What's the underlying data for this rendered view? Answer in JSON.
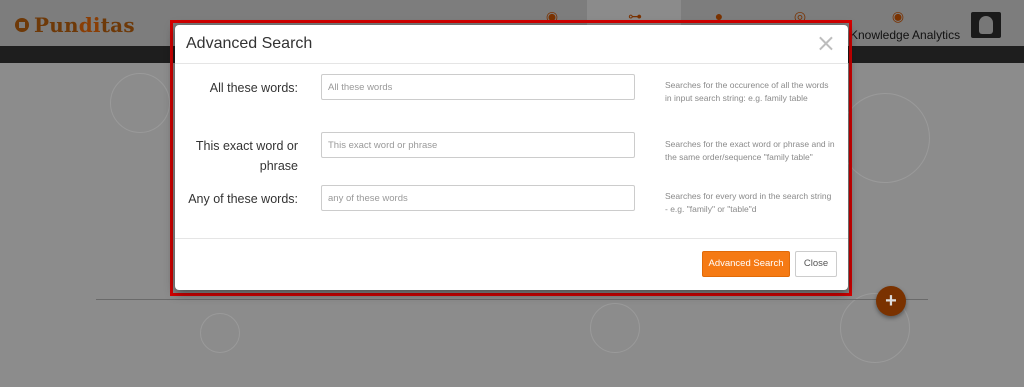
{
  "app": {
    "logo_prefix": "Pun",
    "logo_accent": "di",
    "logo_suffix": "tas",
    "nav_label": "Knowledge Analytics",
    "accent_color": "#f57a14",
    "brand_color": "#7a3200"
  },
  "nav_icons": [
    "dashboard-icon",
    "network-icon",
    "lightbulb-icon",
    "target-icon",
    "knowledge-analytics-icon"
  ],
  "modal": {
    "title": "Advanced Search",
    "close_icon": "×",
    "rows": [
      {
        "label": "All these words:",
        "placeholder": "All these words",
        "help": "Searches for the occurence of all the words in input search string: e.g. family table"
      },
      {
        "label": "This exact word or phrase",
        "placeholder": "This exact word or phrase",
        "help": "Searches for the exact word or phrase and in the same order/sequence \"family table\""
      },
      {
        "label": "Any of these words:",
        "placeholder": "any of these words",
        "help": "Searches for every word in the search string - e.g. \"family\" or \"table\"d"
      }
    ],
    "primary_button": "Advanced Search",
    "secondary_button": "Close"
  },
  "fab_symbol": "+"
}
